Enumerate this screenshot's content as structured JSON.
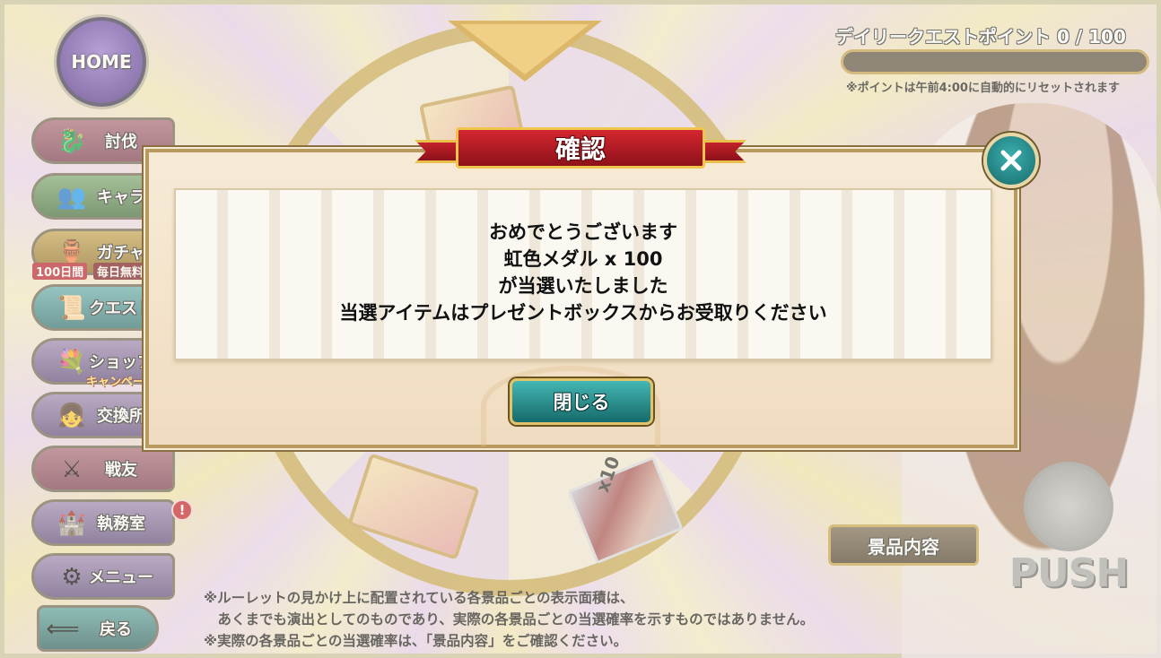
{
  "home": {
    "label": "HOME"
  },
  "menu": [
    {
      "label": "討伐",
      "icon": "dragon-icon"
    },
    {
      "label": "キャラ",
      "icon": "characters-icon"
    },
    {
      "label": "ガチャ",
      "icon": "gacha-pot-icon",
      "badge_left": "100日間",
      "badge_right": "毎日無料"
    },
    {
      "label": "クエスト",
      "icon": "quest-scroll-icon"
    },
    {
      "label": "ショップ",
      "icon": "shop-flowers-icon",
      "badge": "キャンペーン中"
    },
    {
      "label": "交換所",
      "icon": "exchange-girl-icon"
    },
    {
      "label": "戦友",
      "icon": "crossed-swords-icon"
    },
    {
      "label": "執務室",
      "icon": "office-banner-icon",
      "alert": "!"
    },
    {
      "label": "メニュー",
      "icon": "gear-icon"
    },
    {
      "label": "戻る",
      "icon": "back-arrow-icon"
    }
  ],
  "quest_points": {
    "title": "デイリークエストポイント 0 / 100",
    "current": 0,
    "max": 100,
    "note": "※ポイントは午前4:00に自動的にリセットされます"
  },
  "prize_list_button": "景品内容",
  "push_button": "PUSH",
  "prizes": {
    "ticket_count": "x10"
  },
  "disclaimer": {
    "line1": "※ルーレットの見かけ上に配置されている各景品ごとの表示面積は、",
    "line2": "　あくまでも演出としてのものであり、実際の各景品ごとの当選確率を示すものではありません。",
    "line3": "※実際の各景品ごとの当選確率は、「景品内容」をご確認ください。"
  },
  "modal": {
    "title": "確認",
    "lines": [
      "おめでとうございます",
      "虹色メダル x 100",
      "が当選いたしました",
      "当選アイテムはプレゼントボックスからお受取りください"
    ],
    "close_button": "閉じる"
  },
  "colors": {
    "ribbon_red": "#c3222b",
    "button_teal": "#2a9896",
    "frame_gold": "#c8a44a"
  }
}
